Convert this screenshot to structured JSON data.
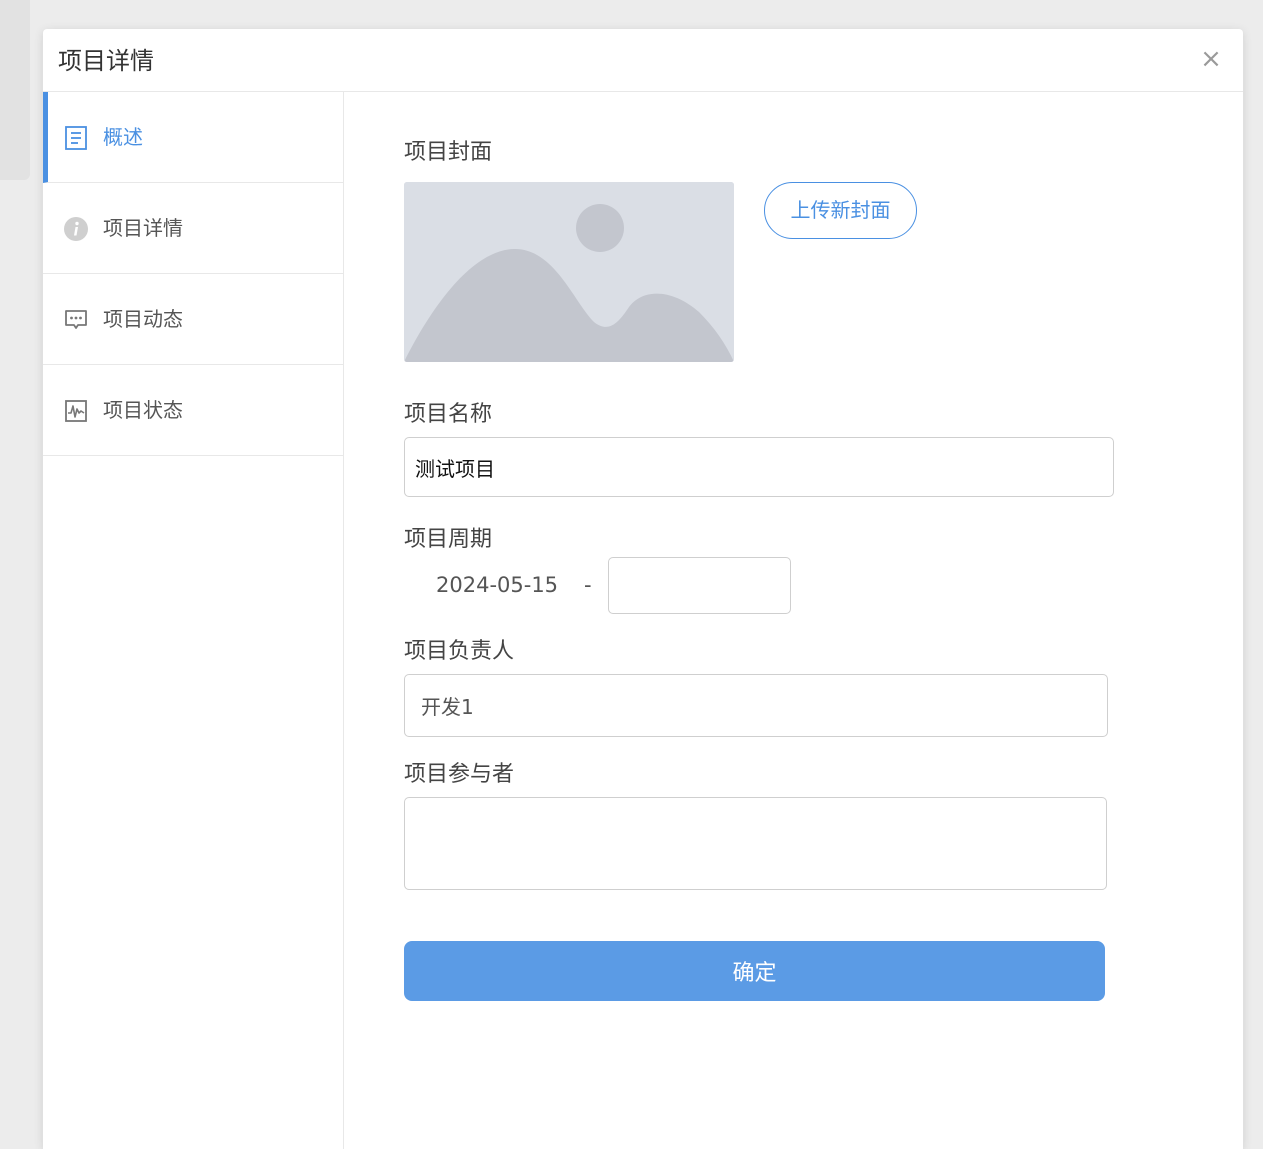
{
  "modal": {
    "title": "项目详情",
    "close_label": "×"
  },
  "sidebar": {
    "items": [
      {
        "label": "概述",
        "icon": "document-icon",
        "active": true
      },
      {
        "label": "项目详情",
        "icon": "info-icon",
        "active": false
      },
      {
        "label": "项目动态",
        "icon": "comment-icon",
        "active": false
      },
      {
        "label": "项目状态",
        "icon": "activity-chart-icon",
        "active": false
      }
    ]
  },
  "form": {
    "cover_label": "项目封面",
    "cover_image_icon": "image-placeholder-icon",
    "upload_button": "上传新封面",
    "name_label": "项目名称",
    "name_value": "测试项目",
    "period_label": "项目周期",
    "period_start": "2024-05-15",
    "period_separator": "-",
    "period_end": "",
    "owner_label": "项目负责人",
    "owner_value": "开发1",
    "participants_label": "项目参与者",
    "participants_value": "",
    "confirm_button": "确定"
  },
  "colors": {
    "accent": "#4a90e2",
    "button_bg": "#5b9be5",
    "border": "#cfcfcf"
  }
}
